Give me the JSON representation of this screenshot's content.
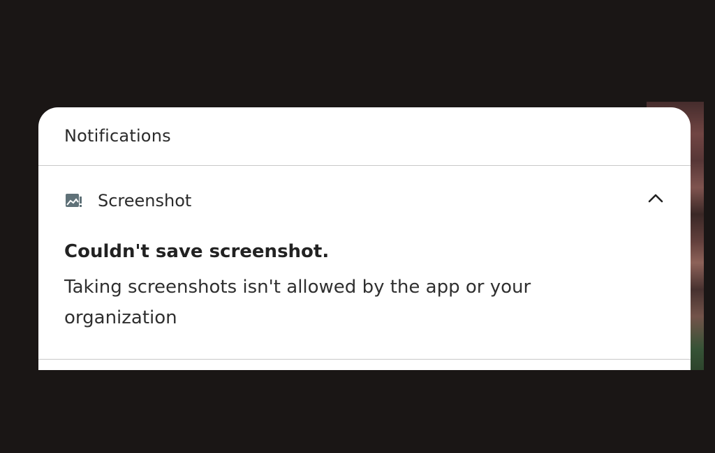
{
  "panel": {
    "title": "Notifications"
  },
  "notification": {
    "app_icon": "screenshot-error-icon",
    "app_name": "Screenshot",
    "expand_icon": "chevron-up-icon",
    "title": "Couldn't save screenshot.",
    "text": "Taking screenshots isn't allowed by the app or your organization"
  },
  "colors": {
    "background": "#1a1615",
    "panel": "#ffffff",
    "icon": "#5f7178",
    "divider": "#c8c8c8",
    "text": "#2b2b2b"
  }
}
